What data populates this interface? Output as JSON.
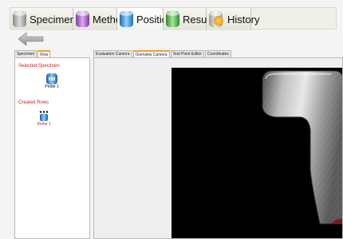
{
  "top_tabs": [
    {
      "label": "Specimen",
      "icon": "specimen-icon"
    },
    {
      "label": "Method",
      "icon": "method-icon"
    },
    {
      "label": "Position",
      "icon": "position-icon"
    },
    {
      "label": "Result",
      "icon": "result-icon"
    },
    {
      "label": "History",
      "icon": "history-icon"
    }
  ],
  "active_top_tab": "Position",
  "left_tabs": [
    "Specimen",
    "Row"
  ],
  "active_left_tab": "Row",
  "left_panel": {
    "selected_heading": "Selected Specimen",
    "selected_item": "Probe 1",
    "created_heading": "Created Rows",
    "created_item": "Reihe 1"
  },
  "right_tabs": [
    "Evaluation Camera",
    "Overview Camera",
    "Test Point Editor",
    "Coordinates"
  ],
  "active_right_tab": "Overview Camera",
  "colors": {
    "section_heading": "#d42020",
    "active_tab_accent": "#f0a030"
  }
}
